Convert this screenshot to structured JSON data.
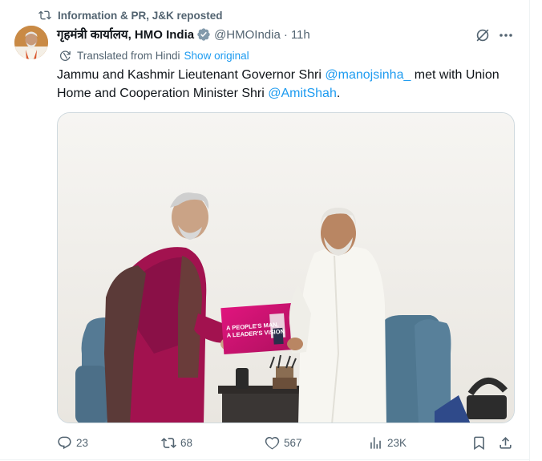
{
  "repost_bar": {
    "text": "Information & PR, J&K reposted",
    "icon": "repost-icon"
  },
  "author": {
    "display_name": "गृहमंत्री कार्यालय, HMO India",
    "handle": "@HMOIndia",
    "separator": "·",
    "time": "11h",
    "verified_icon": "verified-badge-icon",
    "verified_color": "#829aab"
  },
  "translation": {
    "label": "Translated from Hindi",
    "link": "Show original",
    "icon": "translate-icon"
  },
  "tweet": {
    "part1": "Jammu and Kashmir Lieutenant Governor Shri ",
    "mention1": "@manojsinha_",
    "part2": " met with Union Home and Cooperation Minister Shri ",
    "mention2": "@AmitShah",
    "part3": "."
  },
  "book": {
    "title_line1": "A PEOPLE'S MAN,",
    "title_line2": "A LEADER'S VISION"
  },
  "metrics": {
    "replies": "23",
    "reposts": "68",
    "likes": "567",
    "views": "23K"
  },
  "colors": {
    "link": "#1d9bf0",
    "secondary_text": "#536471",
    "primary_text": "#0f1419",
    "border": "#cfd9de"
  }
}
